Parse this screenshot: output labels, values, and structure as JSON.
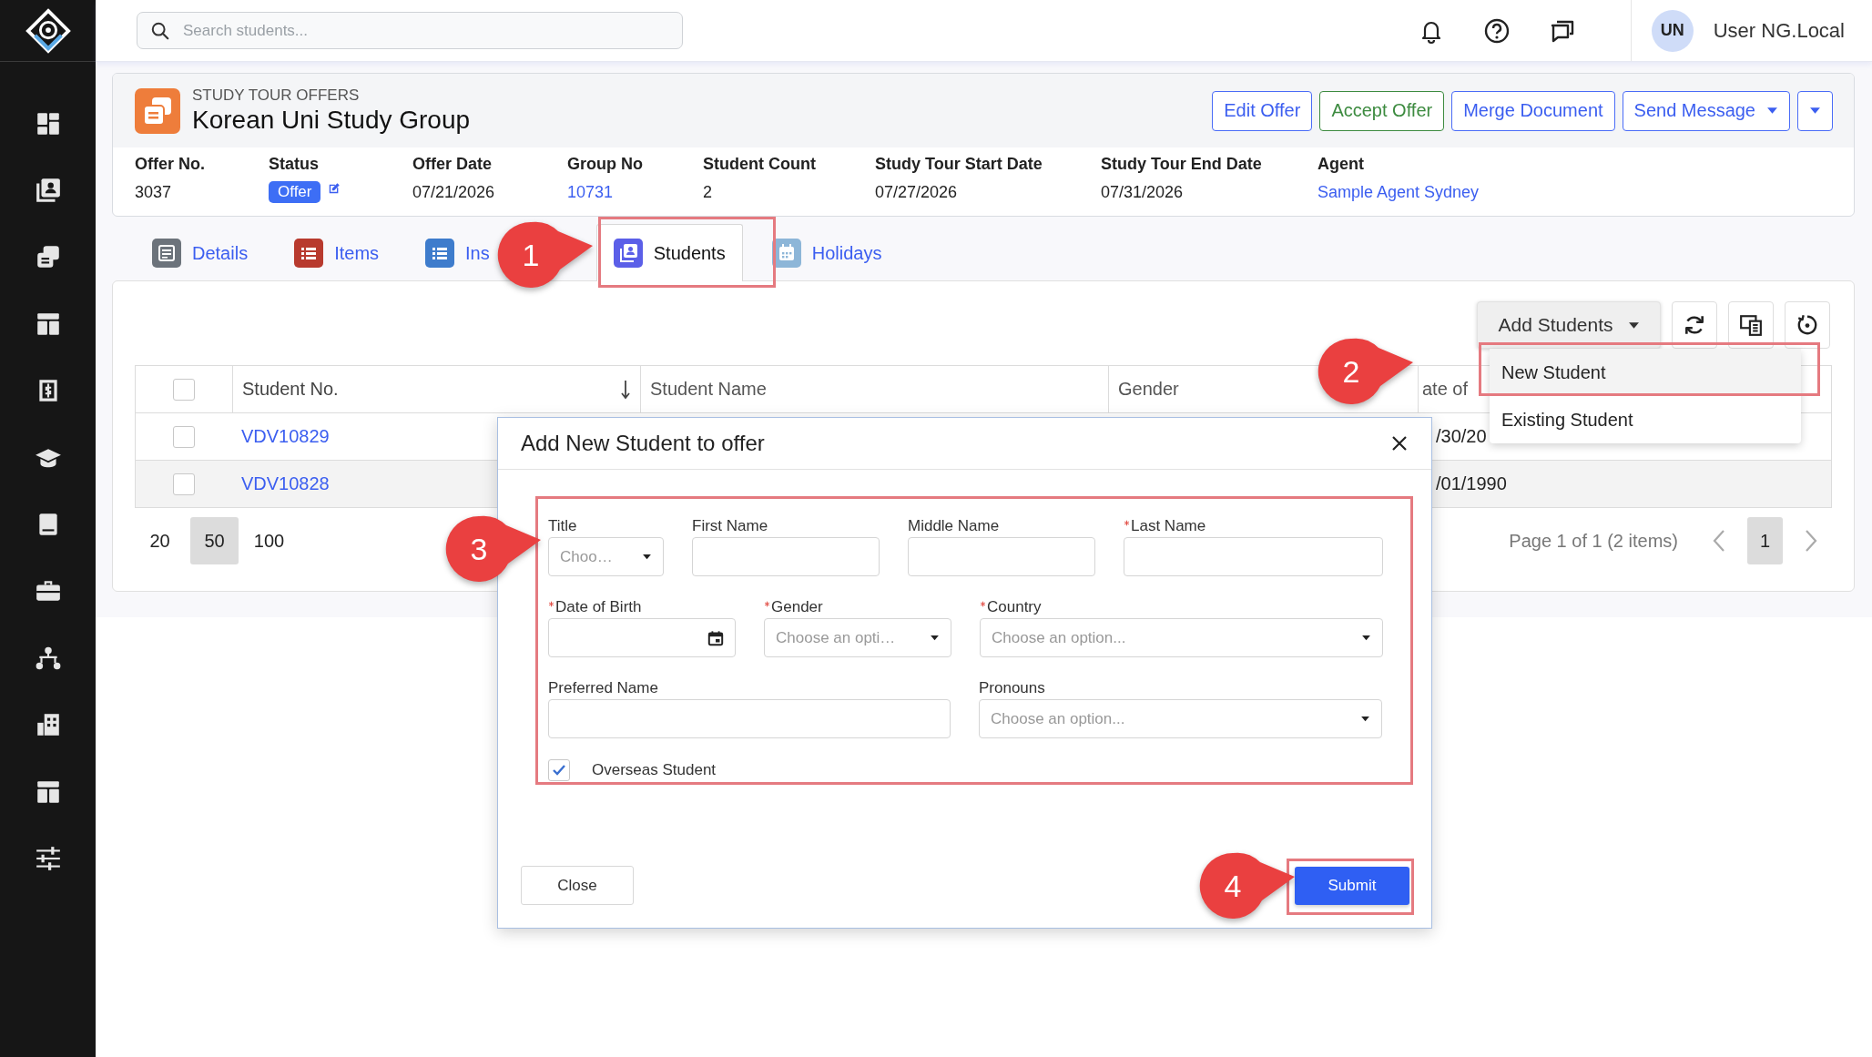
{
  "sidebar": {
    "items": [
      {
        "kind": "dashboard"
      },
      {
        "kind": "contacts"
      },
      {
        "kind": "offers"
      },
      {
        "kind": "layout"
      },
      {
        "kind": "invoice"
      },
      {
        "kind": "graduation"
      },
      {
        "kind": "book"
      },
      {
        "kind": "briefcase"
      },
      {
        "kind": "network"
      },
      {
        "kind": "building"
      },
      {
        "kind": "layout"
      },
      {
        "kind": "sliders"
      }
    ]
  },
  "topbar": {
    "search": {
      "placeholder": "Search students..."
    },
    "user": {
      "initials": "UN",
      "name": "User NG.Local"
    }
  },
  "header": {
    "section": "STUDY TOUR OFFERS",
    "title": "Korean Uni Study Group",
    "actions": [
      {
        "kind": "primary",
        "label": "Edit Offer"
      },
      {
        "kind": "success",
        "label": "Accept Offer"
      },
      {
        "kind": "primary",
        "label": "Merge Document"
      },
      {
        "kind": "dropdown",
        "label": "Send Message"
      },
      {
        "kind": "caret"
      }
    ],
    "fields": [
      {
        "label": "Offer No.",
        "value": "3037",
        "kind": "text"
      },
      {
        "label": "Status",
        "value": "Offer",
        "kind": "badge",
        "editable": true
      },
      {
        "label": "Offer Date",
        "value": "07/21/2026",
        "kind": "text"
      },
      {
        "label": "Group No",
        "value": "10731",
        "kind": "link"
      },
      {
        "label": "Student Count",
        "value": "2",
        "kind": "text"
      },
      {
        "label": "Study Tour Start Date",
        "value": "07/27/2026",
        "kind": "text"
      },
      {
        "label": "Study Tour End Date",
        "value": "07/31/2026",
        "kind": "text"
      },
      {
        "label": "Agent",
        "value": "Sample Agent Sydney",
        "kind": "link"
      }
    ]
  },
  "tabs": [
    {
      "label": "Details",
      "kind": "document",
      "color": "#6c737b",
      "selected": false
    },
    {
      "label": "Items",
      "kind": "list",
      "color": "#b83a2e",
      "selected": false
    },
    {
      "label": "Ins",
      "kind": "list",
      "color": "#3e7ccc",
      "selected": false
    },
    {
      "label": "Students",
      "kind": "contacts",
      "color": "#5b5fe8",
      "selected": true
    },
    {
      "label": "Holidays",
      "kind": "calendar",
      "color": "#8db6d8",
      "selected": false
    }
  ],
  "toolbar": {
    "add_button": "Add Students",
    "menu": [
      {
        "label": "New Student",
        "selected": true
      },
      {
        "label": "Existing Student",
        "selected": false
      }
    ]
  },
  "table": {
    "select_all_checked": false,
    "columns": [
      {
        "label": "Student No.",
        "sorted": true
      },
      {
        "label": "Student Name",
        "sorted": false
      },
      {
        "label": "Gender",
        "sorted": false
      },
      {
        "label": "ate of",
        "sorted": false
      }
    ],
    "rows": [
      {
        "checked": false,
        "hovered": false,
        "student_no": "VDV10829",
        "date_of_birth": "/30/20"
      },
      {
        "checked": false,
        "hovered": true,
        "student_no": "VDV10828",
        "date_of_birth": "/01/1990"
      }
    ]
  },
  "pagination": {
    "page_sizes": [
      {
        "label": "20",
        "selected": false
      },
      {
        "label": "50",
        "selected": true
      },
      {
        "label": "100",
        "selected": false
      }
    ],
    "summary": "Page 1 of 1 (2 items)",
    "pages": [
      {
        "label": "1",
        "selected": true
      }
    ]
  },
  "dialog": {
    "title": "Add New Student to offer",
    "form_rows": [
      [
        {
          "label": "Title",
          "required": false,
          "kind": "select",
          "placeholder": "Choo…"
        },
        {
          "label": "First Name",
          "required": false,
          "kind": "text"
        },
        {
          "label": "Middle Name",
          "required": false,
          "kind": "text"
        },
        {
          "label": "Last Name",
          "required": true,
          "kind": "text"
        }
      ],
      [
        {
          "label": "Date of Birth",
          "required": true,
          "kind": "date"
        },
        {
          "label": "Gender",
          "required": true,
          "kind": "select",
          "placeholder": "Choose an opti…"
        },
        {
          "label": "Country",
          "required": true,
          "kind": "select",
          "placeholder": "Choose an option..."
        }
      ],
      [
        {
          "label": "Preferred Name",
          "required": false,
          "kind": "text"
        },
        {
          "label": "Pronouns",
          "required": false,
          "kind": "select",
          "placeholder": "Choose an option..."
        }
      ]
    ],
    "overseas": {
      "label": "Overseas Student",
      "checked": true
    },
    "close_button": "Close",
    "submit_button": "Submit"
  },
  "annotations": [
    {
      "number": "1"
    },
    {
      "number": "2"
    },
    {
      "number": "3"
    },
    {
      "number": "4"
    }
  ]
}
